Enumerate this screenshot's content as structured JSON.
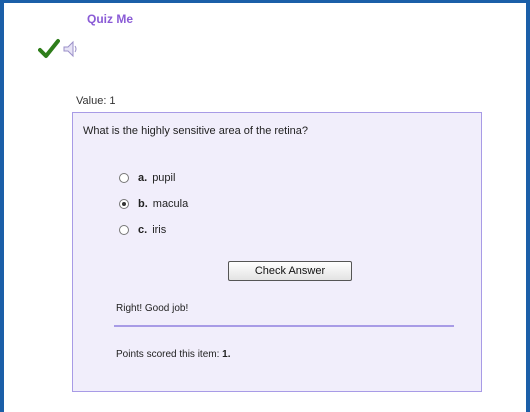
{
  "quiz": {
    "title": "Quiz Me",
    "icons": [
      "check-icon",
      "speaker-icon"
    ],
    "value_label": "Value: 1",
    "question": "What is the highly sensitive area of the retina?",
    "options": [
      {
        "letter": "a.",
        "text": "pupil",
        "selected": false
      },
      {
        "letter": "b.",
        "text": "macula",
        "selected": true
      },
      {
        "letter": "c.",
        "text": "iris",
        "selected": false
      }
    ],
    "check_button_label": "Check Answer",
    "feedback": "Right! Good job!",
    "points_label": "Points scored this item:",
    "points_value": "1."
  },
  "colors": {
    "frame_border": "#1b5fa8",
    "title": "#8a5bd6",
    "panel_background": "#f1eefb",
    "panel_border": "#a89be6",
    "checkmark": "#2e7d1a"
  }
}
